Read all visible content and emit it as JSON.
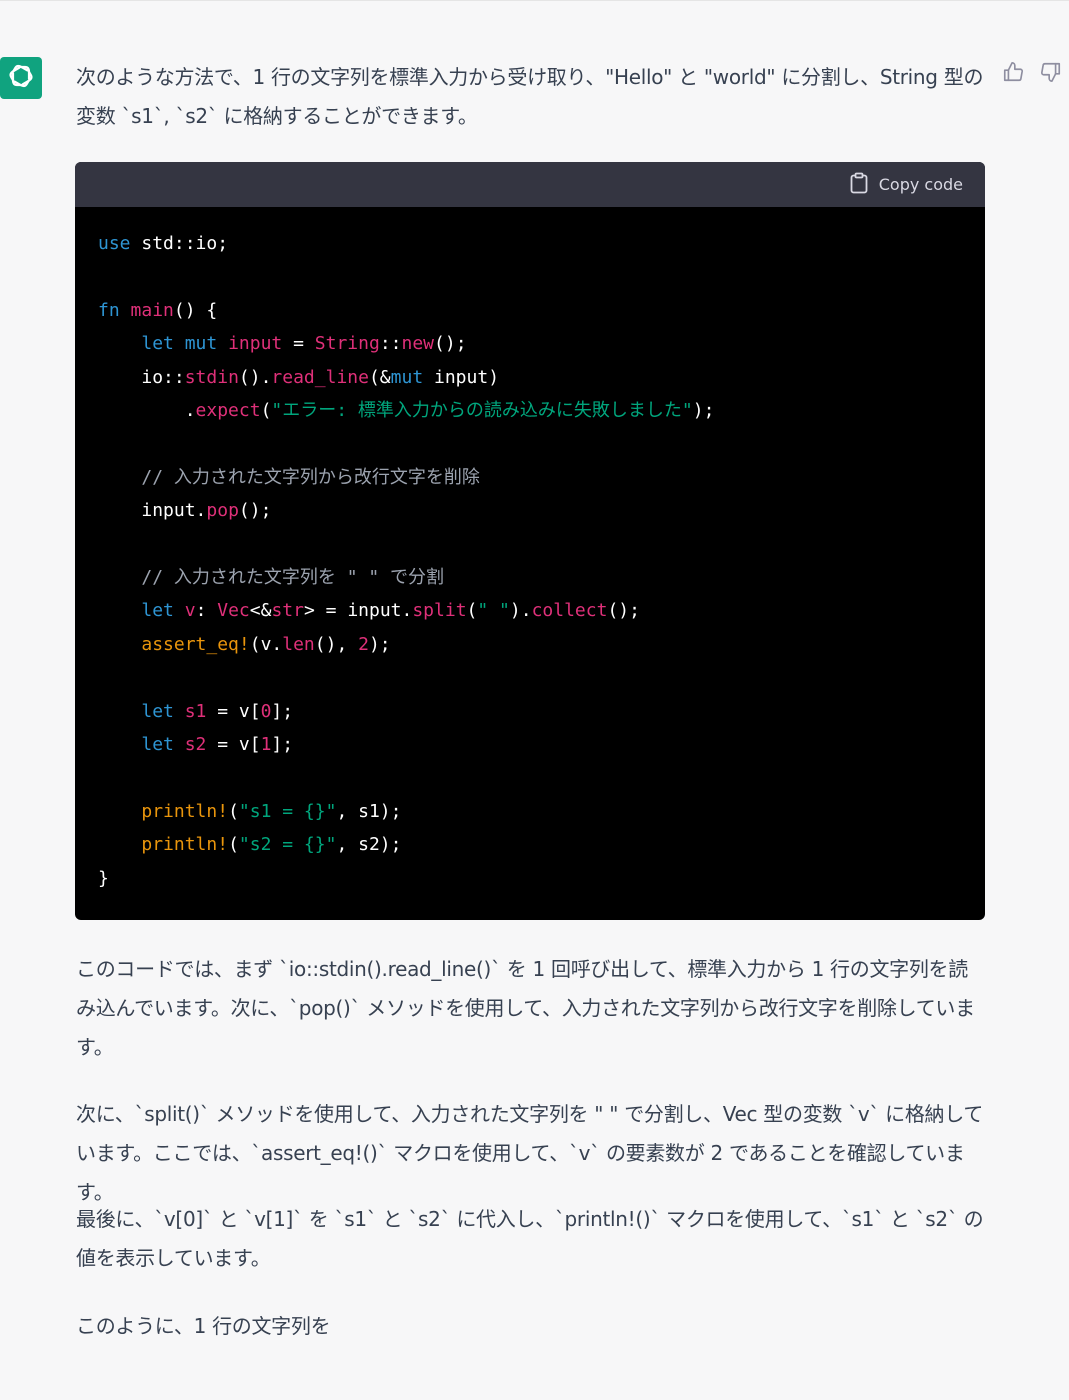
{
  "message": {
    "intro": "次のような方法で、1 行の文字列を標準入力から受け取り、\"Hello\" と \"world\" に分割し、String 型の変数 `s1`, `s2` に格納することができます。",
    "copy_label": "Copy code",
    "para1": "このコードでは、まず `io::stdin().read_line()` を 1 回呼び出して、標準入力から 1 行の文字列を読み込んでいます。次に、`pop()` メソッドを使用して、入力された文字列から改行文字を削除しています。",
    "para2": "次に、`split()` メソッドを使用して、入力された文字列を \" \" で分割し、Vec 型の変数 `v` に格納しています。ここでは、`assert_eq!()` マクロを使用して、`v` の要素数が 2 であることを確認しています。",
    "para3": "最後に、`v[0]` と `v[1]` を `s1` と `s2` に代入し、`println!()` マクロを使用して、`s1` と `s2` の値を表示しています。",
    "para4": "このように、1 行の文字列を"
  },
  "code": {
    "l1_use": "use",
    "l1_rest": " std::io;",
    "l3_fn": "fn",
    "l3_main": " main",
    "l3_rest": "() {",
    "l4_let": "let",
    "l4_mut": " mut",
    "l4_var": " input",
    "l4_eq": " = ",
    "l4_type": "String",
    "l4_sep": "::",
    "l4_new": "new",
    "l4_end": "();",
    "l5_io": "io::",
    "l5_stdin": "stdin",
    "l5_dot": "().",
    "l5_read": "read_line",
    "l5_amp": "(&",
    "l5_mut": "mut",
    "l5_end": " input)",
    "l6_dot": ".",
    "l6_expect": "expect",
    "l6_open": "(",
    "l6_str": "\"エラー: 標準入力からの読み込みに失敗しました\"",
    "l6_end": ");",
    "l8_comment": "// 入力された文字列から改行文字を削除",
    "l9_input": "input.",
    "l9_pop": "pop",
    "l9_end": "();",
    "l11_comment": "// 入力された文字列を \" \" で分割",
    "l12_let": "let",
    "l12_v": " v",
    "l12_colon": ": ",
    "l12_vec": "Vec",
    "l12_lt": "<&",
    "l12_str": "str",
    "l12_gt": "> = input.",
    "l12_split": "split",
    "l12_open": "(",
    "l12_sp": "\" \"",
    "l12_close": ").",
    "l12_collect": "collect",
    "l12_end": "();",
    "l13_macro": "assert_eq!",
    "l13_open": "(v.",
    "l13_len": "len",
    "l13_mid": "(), ",
    "l13_num": "2",
    "l13_end": ");",
    "l15_let": "let",
    "l15_var": " s1",
    "l15_eq": " = v[",
    "l15_num": "0",
    "l15_end": "];",
    "l16_let": "let",
    "l16_var": " s2",
    "l16_eq": " = v[",
    "l16_num": "1",
    "l16_end": "];",
    "l18_macro": "println!",
    "l18_open": "(",
    "l18_str": "\"s1 = {}\"",
    "l18_end": ", s1);",
    "l19_macro": "println!",
    "l19_open": "(",
    "l19_str": "\"s2 = {}\"",
    "l19_end": ", s2);",
    "l20_close": "}"
  },
  "icons": [
    "openai-logo-icon",
    "clipboard-icon",
    "thumbs-up-icon",
    "thumbs-down-icon"
  ],
  "colors": {
    "avatar_bg": "#10a37f",
    "keyword": "#2e95d3",
    "function": "#df3079",
    "string": "#00a67d",
    "macro": "#e9950c",
    "comment": "#9ca3af"
  }
}
